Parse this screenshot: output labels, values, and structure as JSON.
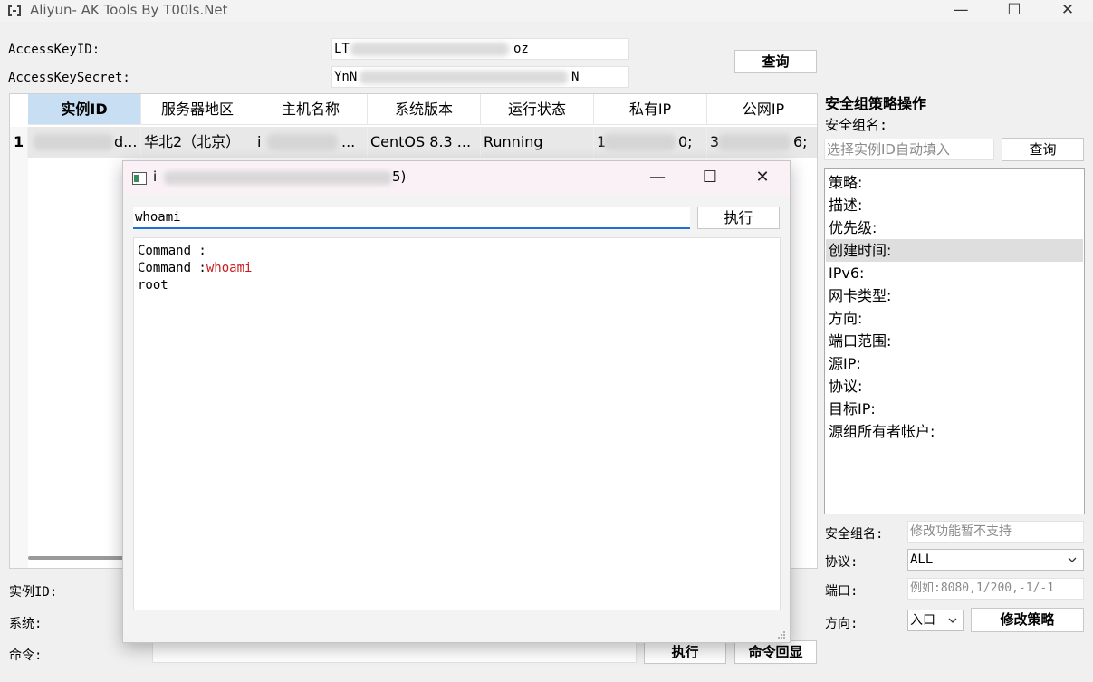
{
  "window": {
    "title": "Aliyun- AK Tools By T00ls.Net",
    "minimize_glyph": "—",
    "maximize_glyph": "☐",
    "close_glyph": "✕"
  },
  "credentials": {
    "access_key_id_label": "AccessKeyID:",
    "access_key_id_prefix": "LT",
    "access_key_id_suffix": "oz",
    "access_key_secret_label": "AccessKeySecret:",
    "access_key_secret_prefix": "YnN",
    "access_key_secret_suffix": "N",
    "query_button": "查询"
  },
  "table": {
    "columns": [
      "实例ID",
      "服务器地区",
      "主机名称",
      "系统版本",
      "运行状态",
      "私有IP",
      "公网IP"
    ],
    "rows": [
      {
        "row_number": "1",
        "instance_id": "d...",
        "region": "华北2（北京）",
        "hostname_prefix": "i",
        "hostname_suffix": "...",
        "os": "CentOS  8.3 ...",
        "status": "Running",
        "private_ip_prefix": "1",
        "private_ip_suffix": "0;",
        "public_ip_prefix": "3",
        "public_ip_suffix": "6;"
      }
    ]
  },
  "bottom_form": {
    "instance_id_label": "实例ID:",
    "system_label": "系统:",
    "command_label": "命令:",
    "execute_button": "执行",
    "echo_button": "命令回显"
  },
  "modal": {
    "title_prefix": "i",
    "title_suffix": "5)",
    "command_value": "whoami",
    "execute_button": "执行",
    "output": [
      {
        "prefix": "Command :",
        "highlight": ""
      },
      {
        "prefix": "Command :",
        "highlight": "whoami"
      },
      {
        "prefix": "root",
        "highlight": ""
      }
    ],
    "highlight_color": "#c81e1e"
  },
  "security_group": {
    "section_title": "安全组策略操作",
    "group_name_label": "安全组名:",
    "group_name_placeholder": "选择实例ID自动填入",
    "query_button": "查询",
    "policy_items": [
      "策略:",
      "描述:",
      "优先级:",
      "创建时间:",
      "IPv6:",
      "网卡类型:",
      "方向:",
      "端口范围:",
      "源IP:",
      "协议:",
      "目标IP:",
      "源组所有者帐户:"
    ],
    "selected_index": 3,
    "edit_group_name_label": "安全组名:",
    "edit_group_name_placeholder": "修改功能暂不支持",
    "protocol_label": "协议:",
    "protocol_value": "ALL",
    "port_label": "端口:",
    "port_placeholder": "例如:8080,1/200,-1/-1",
    "direction_label": "方向:",
    "direction_value": "入口",
    "modify_button": "修改策略"
  }
}
